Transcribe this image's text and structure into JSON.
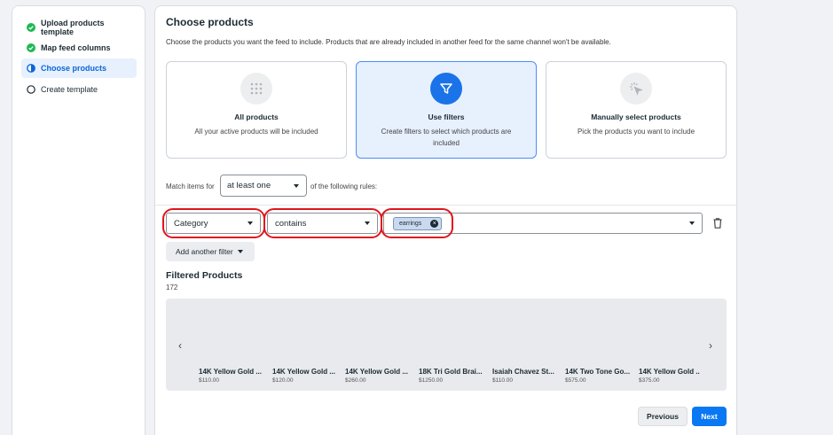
{
  "sidebar": {
    "steps": [
      {
        "label": "Upload products template",
        "state": "done"
      },
      {
        "label": "Map feed columns",
        "state": "done"
      },
      {
        "label": "Choose products",
        "state": "active"
      },
      {
        "label": "Create template",
        "state": "pending"
      }
    ]
  },
  "main": {
    "title": "Choose products",
    "subtitle": "Choose the products you want the feed to include. Products that are already included in another feed for the same channel won't be available.",
    "cards": [
      {
        "title": "All products",
        "description": "All your active products will be included",
        "icon": "grid-dots-icon",
        "selected": false
      },
      {
        "title": "Use filters",
        "description": "Create filters to select which products are included",
        "icon": "filter-icon",
        "selected": true
      },
      {
        "title": "Manually select products",
        "description": "Pick the products you want to include",
        "icon": "cursor-select-icon",
        "selected": false
      }
    ],
    "match": {
      "prefix": "Match items for",
      "value": "at least one",
      "suffix": "of the following rules:"
    },
    "filter_rule": {
      "field": "Category",
      "operator": "contains",
      "value_chip": "earrings"
    },
    "add_filter_label": "Add another filter",
    "filtered_title": "Filtered Products",
    "filtered_count": "172",
    "products": [
      {
        "name": "14K Yellow Gold ...",
        "price": "$110.00"
      },
      {
        "name": "14K Yellow Gold ...",
        "price": "$120.00"
      },
      {
        "name": "14K Yellow Gold ...",
        "price": "$260.00"
      },
      {
        "name": "18K Tri Gold Brai...",
        "price": "$1250.00"
      },
      {
        "name": "Isaiah Chavez St...",
        "price": "$110.00"
      },
      {
        "name": "14K Two Tone Go...",
        "price": "$575.00"
      },
      {
        "name": "14K Yellow Gold ..",
        "price": "$375.00"
      }
    ],
    "prev_label": "Previous",
    "next_label": "Next"
  },
  "colors": {
    "accent": "#0a78f2",
    "done_green": "#1db954",
    "highlight_red": "#e0151d"
  }
}
